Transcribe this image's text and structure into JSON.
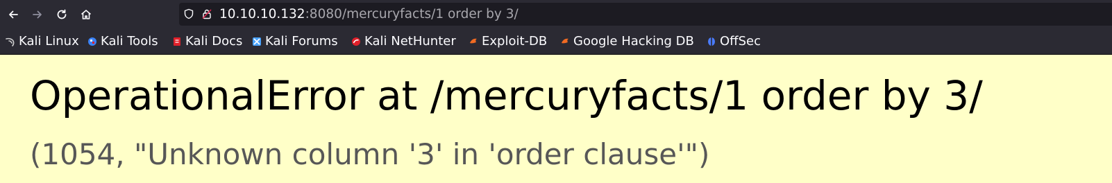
{
  "browser": {
    "nav": {
      "back_icon": "arrow-left-icon",
      "forward_icon": "arrow-right-icon",
      "reload_icon": "reload-icon",
      "home_icon": "home-icon"
    },
    "url": {
      "host": "10.10.10.132",
      "rest": ":8080/mercuryfacts/1 order by 3/"
    },
    "bookmarks": [
      {
        "label": "Kali Linux",
        "icon": "kali-dragon-icon",
        "color": "#cfcfcf"
      },
      {
        "label": "Kali Tools",
        "icon": "kali-tools-icon",
        "color": "#3b82f6"
      },
      {
        "label": "Kali Docs",
        "icon": "kali-docs-icon",
        "color": "#e0202a"
      },
      {
        "label": "Kali Forums",
        "icon": "kali-forums-icon",
        "color": "#4aa3ff"
      },
      {
        "label": "Kali NetHunter",
        "icon": "kali-nethunter-icon",
        "color": "#e0202a"
      },
      {
        "label": "Exploit-DB",
        "icon": "exploit-db-icon",
        "color": "#f06a22"
      },
      {
        "label": "Google Hacking DB",
        "icon": "google-hacking-db-icon",
        "color": "#f06a22"
      },
      {
        "label": "OffSec",
        "icon": "offsec-icon",
        "color": "#4a7cff"
      }
    ]
  },
  "page": {
    "title": "OperationalError at /mercuryfacts/1 order by 3/",
    "message": "(1054, \"Unknown column '3' in 'order clause'\")"
  },
  "colors": {
    "chrome_bg": "#2b2a33",
    "urlbar_bg": "#1c1b22",
    "error_bg": "#ffffc8",
    "message_text": "#575757"
  }
}
